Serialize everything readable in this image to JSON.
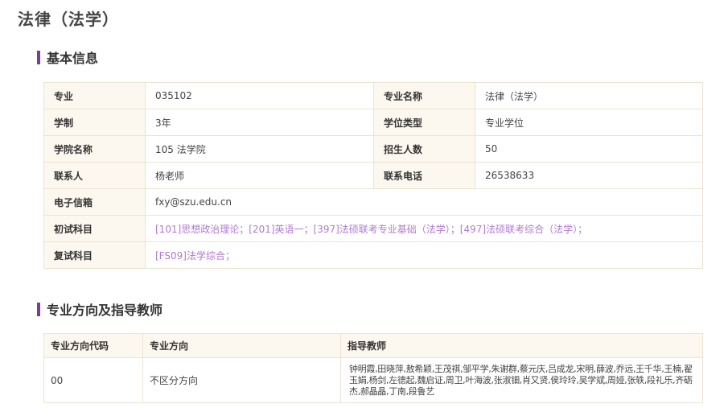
{
  "page": {
    "title": "法律（法学）"
  },
  "sections": {
    "basic_info": "基本信息",
    "directions": "专业方向及指导教师"
  },
  "basic_info": {
    "major_label": "专业",
    "major_value": "035102",
    "major_name_label": "专业名称",
    "major_name_value": "法律（法学）",
    "duration_label": "学制",
    "duration_value": "3年",
    "degree_type_label": "学位类型",
    "degree_type_value": "专业学位",
    "college_label": "学院名称",
    "college_value": "105 法学院",
    "enrollment_label": "招生人数",
    "enrollment_value": "50",
    "contact_label": "联系人",
    "contact_value": "杨老师",
    "phone_label": "联系电话",
    "phone_value": "26538633",
    "email_label": "电子信箱",
    "email_value": "fxy@szu.edu.cn",
    "prelim_label": "初试科目",
    "prelim_value": "[101]思想政治理论；[201]英语一；[397]法硕联考专业基础（法学）；[497]法硕联考综合（法学）；",
    "retest_label": "复试科目",
    "retest_value": "[FS09]法学综合；"
  },
  "directions": {
    "headers": [
      "专业方向代码",
      "专业方向",
      "指导教师"
    ],
    "rows": [
      {
        "code": "00",
        "direction": "不区分方向",
        "teachers": "钟明霞,田晓萍,敖希颖,王茂祺,邹平学,朱谢群,蔡元庆,吕成龙,宋明,薛波,乔远,王千华,王楠,翟玉娟,杨剑,左德起,魏启证,周卫,叶海波,张淑钿,肖又贤,侯玲玲,吴学斌,周娅,张轶,段礼乐,齐砺杰,郝晶晶,丁南,段鲁艺"
      }
    ]
  }
}
